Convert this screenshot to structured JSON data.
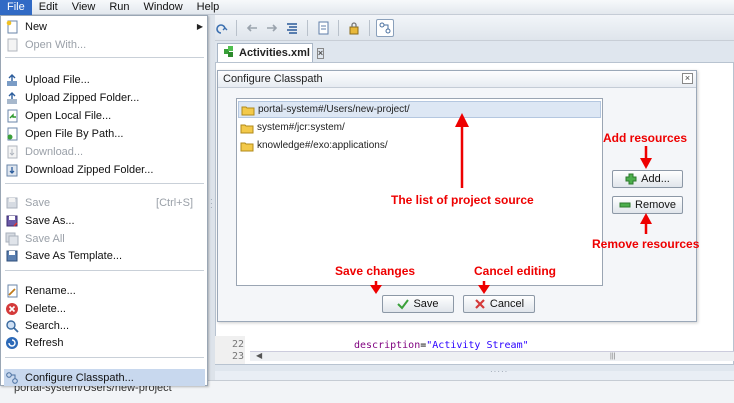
{
  "menubar": {
    "items": [
      "File",
      "Edit",
      "View",
      "Run",
      "Window",
      "Help"
    ]
  },
  "editor": {
    "tab_label": "Activities.xml",
    "tab_close": "×",
    "line_numbers": [
      "22",
      "23"
    ],
    "code_attr": "description",
    "code_eq": "=",
    "code_value": "\"Activity Stream\"",
    "scroll_thumb": "|||"
  },
  "statusbar": {
    "path": "portal-system/Users/new-project"
  },
  "file_menu": {
    "items": [
      {
        "label": "New",
        "icon": "new-file-icon",
        "submenu": true
      },
      {
        "label": "Open With...",
        "icon": "open-with-icon",
        "disabled": true
      },
      {
        "label": "Upload File...",
        "icon": "upload-icon"
      },
      {
        "label": "Upload Zipped Folder...",
        "icon": "upload-zip-icon"
      },
      {
        "label": "Open Local File...",
        "icon": "open-local-icon"
      },
      {
        "label": "Open File By Path...",
        "icon": "open-path-icon"
      },
      {
        "label": "Download...",
        "icon": "download-icon",
        "disabled": true
      },
      {
        "label": "Download Zipped Folder...",
        "icon": "download-zip-icon"
      },
      {
        "label": "Save",
        "icon": "save-icon",
        "disabled": true,
        "shortcut": "[Ctrl+S]"
      },
      {
        "label": "Save As...",
        "icon": "save-as-icon"
      },
      {
        "label": "Save All",
        "icon": "save-all-icon",
        "disabled": true
      },
      {
        "label": "Save As Template...",
        "icon": "save-template-icon"
      },
      {
        "label": "Rename...",
        "icon": "rename-icon"
      },
      {
        "label": "Delete...",
        "icon": "delete-icon"
      },
      {
        "label": "Search...",
        "icon": "search-icon"
      },
      {
        "label": "Refresh",
        "icon": "refresh-icon"
      },
      {
        "label": "Configure Classpath...",
        "icon": "classpath-icon",
        "highlighted": true
      }
    ]
  },
  "dialog": {
    "title": "Configure Classpath",
    "close": "×",
    "classpath_entries": [
      {
        "label": "portal-system#/Users/new-project/",
        "selected": true
      },
      {
        "label": "system#/jcr:system/"
      },
      {
        "label": "knowledge#/exo:applications/"
      }
    ],
    "add_button": "Add...",
    "remove_button": "Remove",
    "save_button": "Save",
    "cancel_button": "Cancel"
  },
  "annotations": {
    "add_resources": "Add resources",
    "list_of_source": "The list of project source",
    "remove_resources": "Remove resources",
    "save_changes": "Save changes",
    "cancel_editing": "Cancel editing"
  },
  "colors": {
    "annotation": "#ee0000",
    "selection": "#dde7f4",
    "menu_highlight": "#c8d8ee"
  }
}
